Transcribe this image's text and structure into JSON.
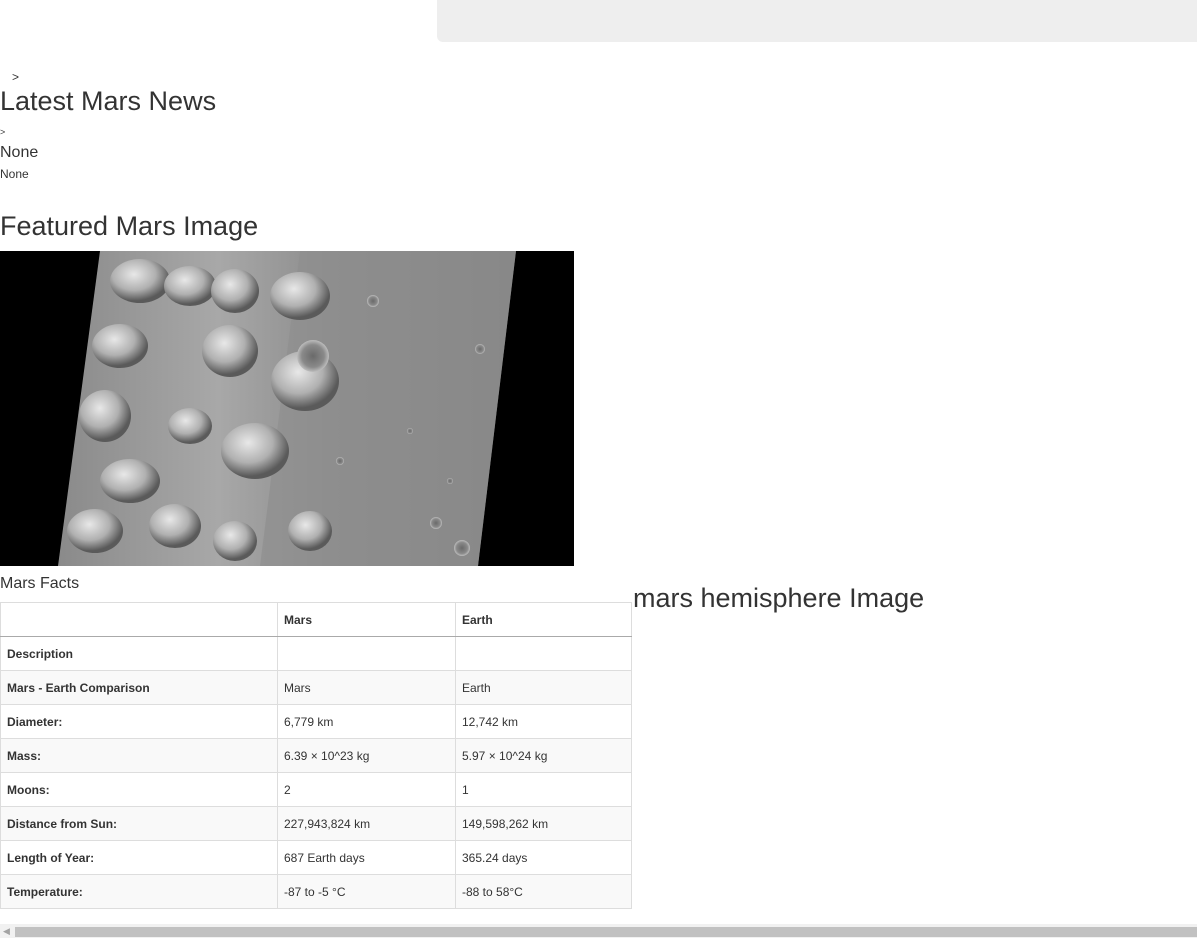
{
  "breadcrumb": {
    "sep1": ">",
    "sep2": ">"
  },
  "news": {
    "title": "Latest Mars News",
    "headline": "None",
    "teaser": "None"
  },
  "featured": {
    "title": "Featured Mars Image"
  },
  "facts": {
    "title": "Mars Facts",
    "columns": [
      "",
      "Mars",
      "Earth"
    ],
    "rows": [
      {
        "label": "Description",
        "mars": "",
        "earth": ""
      },
      {
        "label": "Mars - Earth Comparison",
        "mars": "Mars",
        "earth": "Earth"
      },
      {
        "label": "Diameter:",
        "mars": "6,779 km",
        "earth": "12,742 km"
      },
      {
        "label": "Mass:",
        "mars": "6.39 × 10^23 kg",
        "earth": "5.97 × 10^24 kg"
      },
      {
        "label": "Moons:",
        "mars": "2",
        "earth": "1"
      },
      {
        "label": "Distance from Sun:",
        "mars": "227,943,824 km",
        "earth": "149,598,262 km"
      },
      {
        "label": "Length of Year:",
        "mars": "687 Earth days",
        "earth": "365.24 days"
      },
      {
        "label": "Temperature:",
        "mars": "-87 to -5 °C",
        "earth": "-88 to 58°C"
      }
    ]
  },
  "hemispheres": {
    "title": "mars hemisphere Image"
  },
  "icons": {
    "scroll_left": "scroll-left-arrow-icon"
  }
}
